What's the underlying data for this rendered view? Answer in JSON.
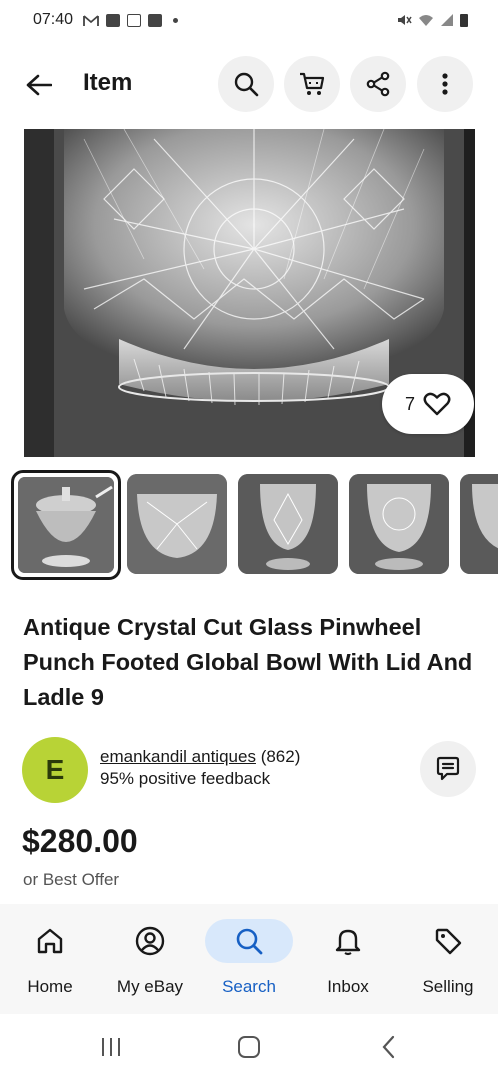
{
  "status_bar": {
    "time": "07:40"
  },
  "top_bar": {
    "title": "Item"
  },
  "listing": {
    "like_count": "7",
    "title": "Antique Crystal Cut Glass Pinwheel Punch Footed Global Bowl With Lid And Ladle 9",
    "seller": {
      "avatar_letter": "E",
      "name": "emankandil antiques",
      "count": "(862)",
      "feedback": "95% positive feedback"
    },
    "price": "$280.00",
    "best_offer": "or Best Offer"
  },
  "bottom_nav": {
    "items": [
      {
        "label": "Home",
        "icon": "home-icon"
      },
      {
        "label": "My eBay",
        "icon": "user-icon"
      },
      {
        "label": "Search",
        "icon": "search-icon",
        "active": true
      },
      {
        "label": "Inbox",
        "icon": "bell-icon"
      },
      {
        "label": "Selling",
        "icon": "tag-icon"
      }
    ]
  },
  "colors": {
    "accent": "#1760c4",
    "active_pill": "#d8e8fb",
    "avatar": "#b8d336"
  }
}
